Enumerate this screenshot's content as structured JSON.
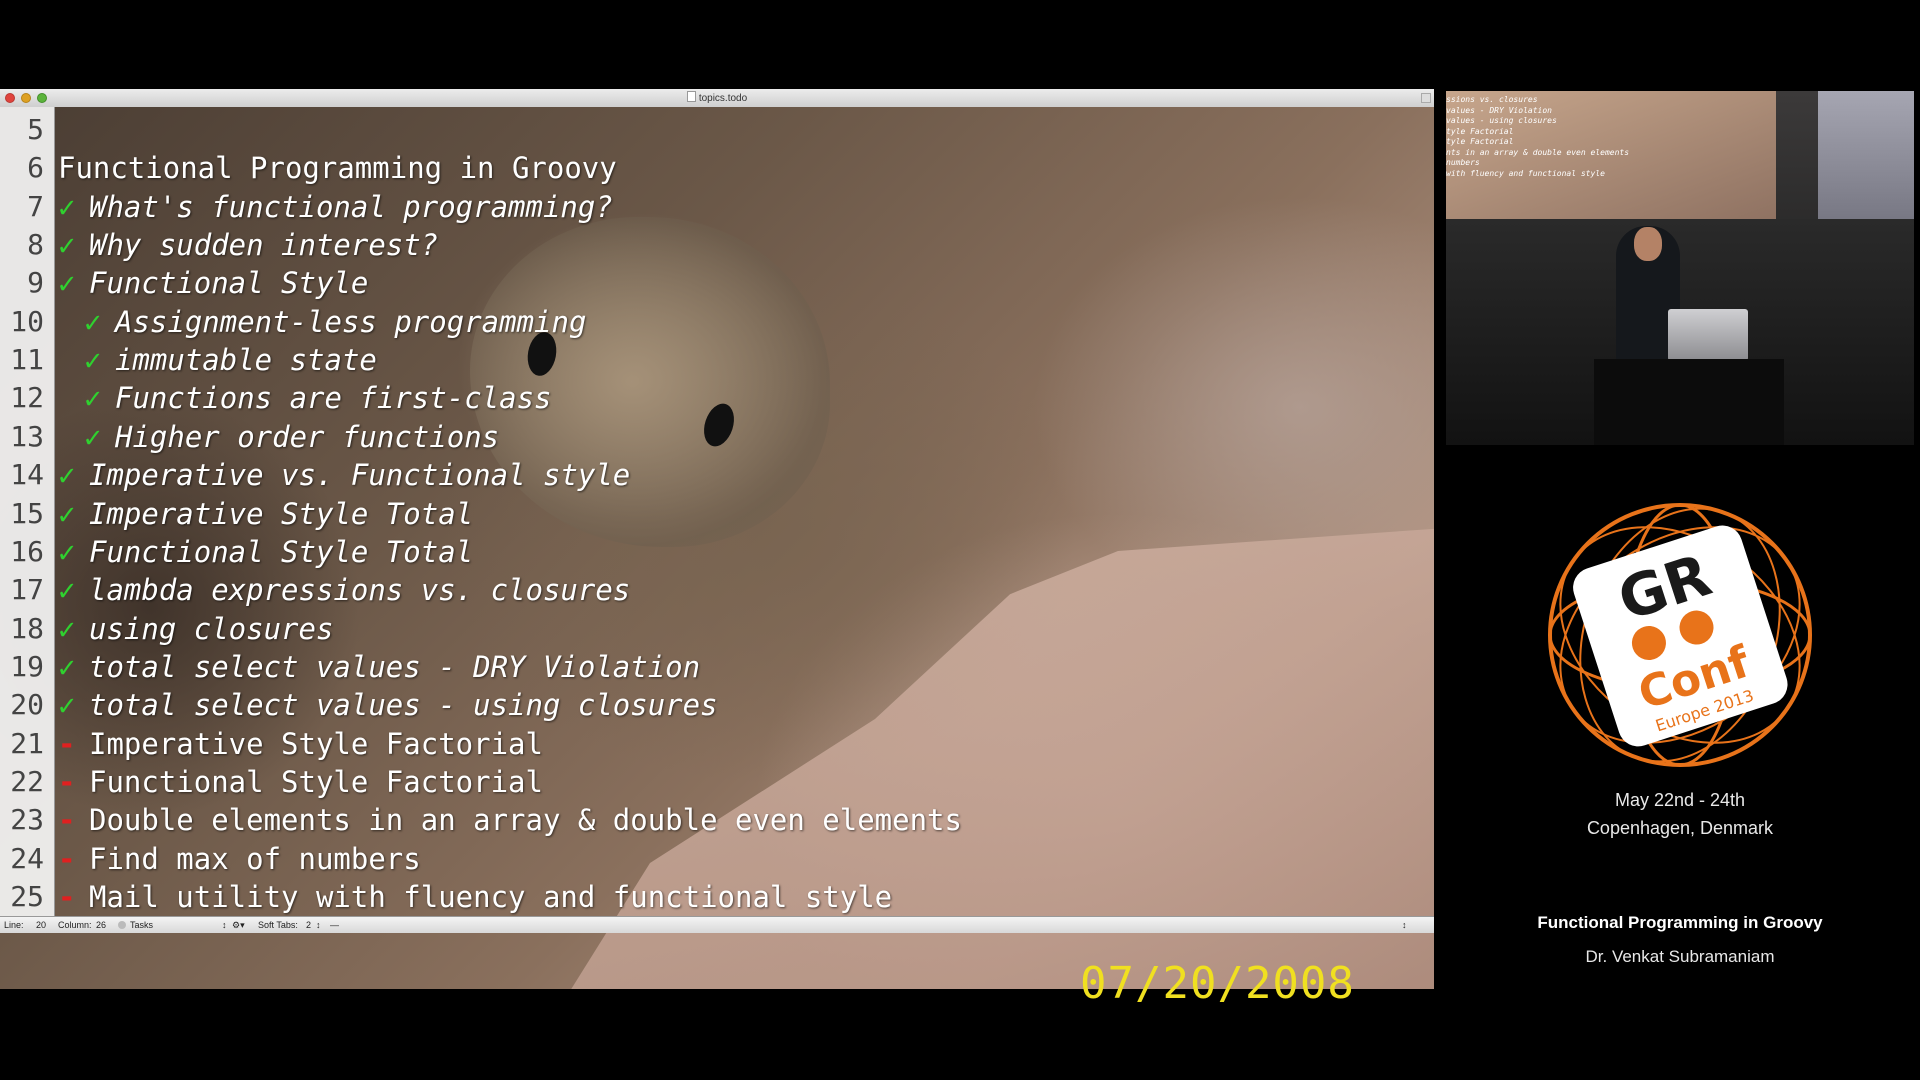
{
  "window": {
    "title": "topics.todo"
  },
  "editor": {
    "lines": [
      {
        "num": "5",
        "marker": "",
        "text": "",
        "italic": false,
        "indent": 0
      },
      {
        "num": "6",
        "marker": "",
        "text": "Functional Programming in Groovy",
        "italic": false,
        "indent": 0
      },
      {
        "num": "7",
        "marker": "✓",
        "text": "What's functional programming?",
        "italic": true,
        "indent": 0
      },
      {
        "num": "8",
        "marker": "✓",
        "text": "Why sudden interest?",
        "italic": true,
        "indent": 0
      },
      {
        "num": "9",
        "marker": "✓",
        "text": "Functional Style",
        "italic": true,
        "indent": 0
      },
      {
        "num": "10",
        "marker": "✓",
        "text": "Assignment-less programming",
        "italic": true,
        "indent": 1
      },
      {
        "num": "11",
        "marker": "✓",
        "text": "immutable state",
        "italic": true,
        "indent": 1
      },
      {
        "num": "12",
        "marker": "✓",
        "text": "Functions are first-class",
        "italic": true,
        "indent": 1
      },
      {
        "num": "13",
        "marker": "✓",
        "text": "Higher order functions",
        "italic": true,
        "indent": 1
      },
      {
        "num": "14",
        "marker": "✓",
        "text": "Imperative vs. Functional style",
        "italic": true,
        "indent": 0
      },
      {
        "num": "15",
        "marker": "✓",
        "text": "Imperative Style Total",
        "italic": true,
        "indent": 0
      },
      {
        "num": "16",
        "marker": "✓",
        "text": "Functional Style Total",
        "italic": true,
        "indent": 0
      },
      {
        "num": "17",
        "marker": "✓",
        "text": "lambda expressions vs. closures",
        "italic": true,
        "indent": 0
      },
      {
        "num": "18",
        "marker": "✓",
        "text": "using closures",
        "italic": true,
        "indent": 0
      },
      {
        "num": "19",
        "marker": "✓",
        "text": "total select values - DRY Violation",
        "italic": true,
        "indent": 0
      },
      {
        "num": "20",
        "marker": "✓",
        "text": "total select values - using closures",
        "italic": true,
        "indent": 0
      },
      {
        "num": "21",
        "marker": "-",
        "text": "Imperative Style Factorial",
        "italic": false,
        "indent": 0
      },
      {
        "num": "22",
        "marker": "-",
        "text": "Functional Style Factorial",
        "italic": false,
        "indent": 0
      },
      {
        "num": "23",
        "marker": "-",
        "text": "Double elements in an array & double even elements",
        "italic": false,
        "indent": 0
      },
      {
        "num": "24",
        "marker": "-",
        "text": "Find max of numbers",
        "italic": false,
        "indent": 0
      },
      {
        "num": "25",
        "marker": "-",
        "text": "Mail utility with fluency and functional style",
        "italic": false,
        "indent": 0
      }
    ],
    "check_color": "#2fd12f",
    "dash_color": "#e02020"
  },
  "statusbar": {
    "line_label": "Line:",
    "line_value": "20",
    "column_label": "Column:",
    "column_value": "26",
    "grammar": "Tasks",
    "soft_tabs_label": "Soft Tabs:",
    "soft_tabs_value": "2",
    "symbol": "—"
  },
  "photo": {
    "date_stamp": "07/20/2008"
  },
  "projection": {
    "lines": [
      "ssions vs. closures",
      "values - DRY Violation",
      "values - using closures",
      "tyle Factorial",
      "tyle Factorial",
      "nts in an array & double even elements",
      "numbers",
      "with fluency and functional style"
    ]
  },
  "logo": {
    "mark": "GR",
    "name": "Conf",
    "edition": "Europe 2013",
    "color": "#e8731a"
  },
  "conference": {
    "dates": "May 22nd - 24th",
    "location": "Copenhagen, Denmark"
  },
  "talk": {
    "title": "Functional Programming in Groovy",
    "speaker": "Dr. Venkat Subramaniam"
  }
}
